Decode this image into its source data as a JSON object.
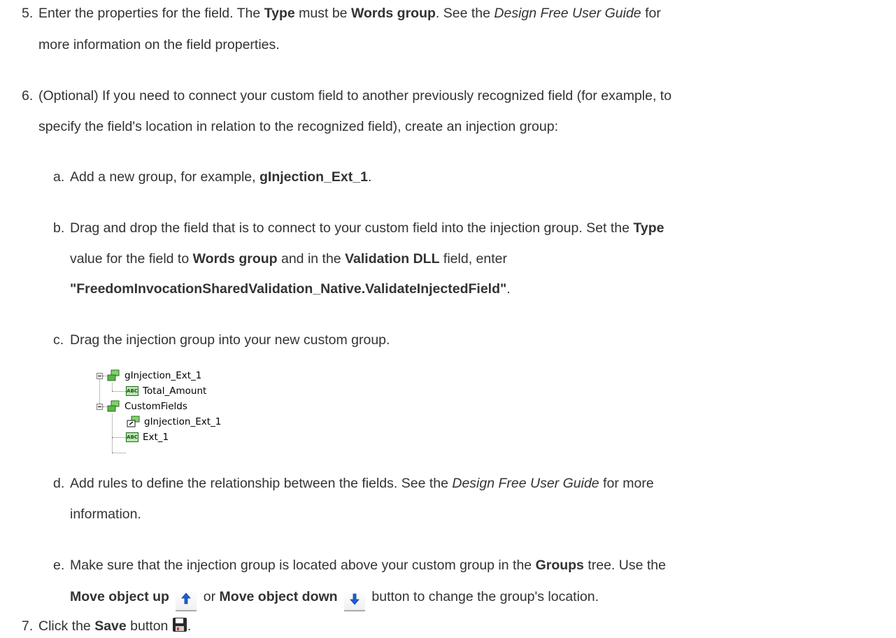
{
  "steps": {
    "s5": {
      "number": "5.",
      "text_before": "Enter the properties for the field. The ",
      "type_bold": "Type",
      "must_be": " must be ",
      "words_group": "Words group",
      "see_the": ". See the ",
      "guide_italic": "Design Free User Guide",
      "for": " for",
      "line2": "more information on the field properties."
    },
    "s6": {
      "number": "6.",
      "line1": "(Optional) If you need to connect your custom field to another previously recognized field (for example, to",
      "line2": "specify the field's location in relation to the recognized field), create an injection group:"
    },
    "sa": {
      "letter": "a.",
      "text": "Add a new group, for example, ",
      "bold": "gInjection_Ext_1",
      "end": "."
    },
    "sb": {
      "letter": "b.",
      "line1": "Drag and drop the field that is to connect to your custom field into the injection group. Set the ",
      "type_bold": "Type",
      "value_for": "value for the field to ",
      "words_group": "Words group",
      "and_in": " and in the ",
      "validation_bold": "Validation DLL",
      "field_enter": " field, enter",
      "code_bold": "\"FreedomInvocationSharedValidation_Native.ValidateInjectedField\"",
      "end": "."
    },
    "sc": {
      "letter": "c.",
      "text": "Drag the injection group into your new custom group."
    },
    "sd": {
      "letter": "d.",
      "text": "Add rules to define the relationship between the fields. See the ",
      "guide_italic": "Design Free User Guide",
      "for_more": " for more",
      "line2": "information."
    },
    "se": {
      "letter": "e.",
      "line1": "Make sure that the injection group is located above your custom group in the ",
      "groups_bold": "Groups",
      "tree_use": " tree. Use the",
      "move_up_bold": "Move object up",
      "or": " or ",
      "move_down_bold": "Move object down",
      "button_to": " button to change the group's location."
    },
    "s7": {
      "number": "7.",
      "click_the": "Click the ",
      "save_bold": "Save",
      "button": " button",
      "end": "."
    }
  },
  "tree": {
    "nodes": [
      {
        "label": "gInjection_Ext_1",
        "icon": "group-icon"
      },
      {
        "label": "Total_Amount",
        "icon": "abc-field-icon",
        "icon_text": "ABC"
      },
      {
        "label": "CustomFields",
        "icon": "group-icon"
      },
      {
        "label": "gInjection_Ext_1",
        "icon": "injection-group-icon"
      },
      {
        "label": "Ext_1",
        "icon": "abc-field-icon",
        "icon_text": "ABC"
      }
    ]
  },
  "icons": {
    "move_up": "arrow-up-icon",
    "move_down": "arrow-down-icon",
    "save": "floppy-disk-icon"
  },
  "colors": {
    "text": "#333333",
    "arrow": "#1a5fd6",
    "group_icon": "#3d9a2e",
    "save_icon": "#2a2a2a"
  }
}
